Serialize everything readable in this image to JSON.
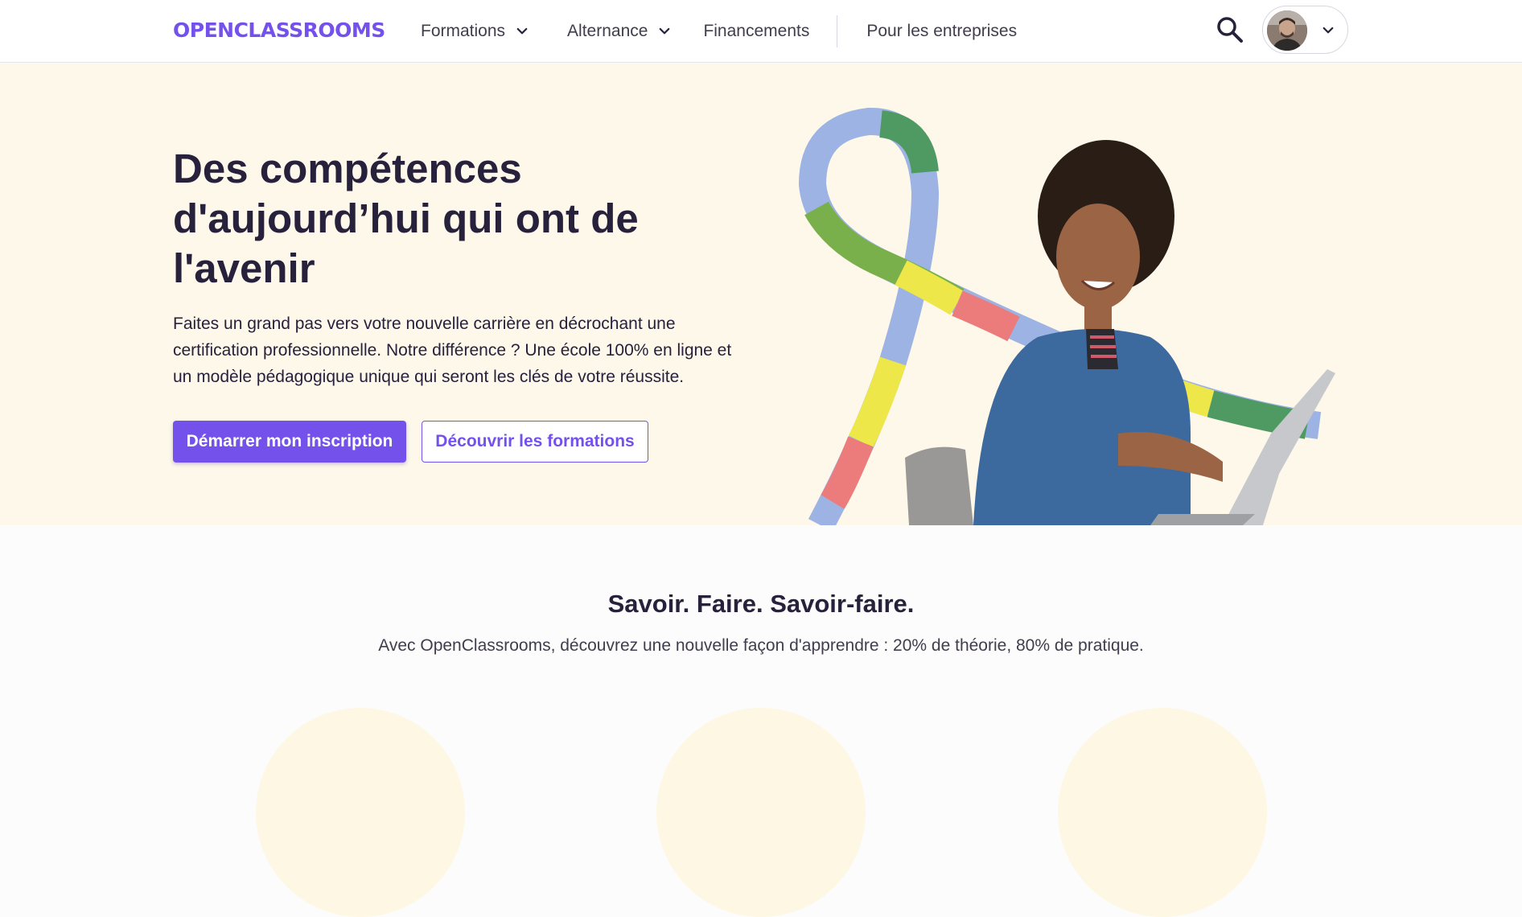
{
  "header": {
    "logo_text": "OPENCLASSROOMS",
    "nav": [
      {
        "label": "Formations",
        "has_dropdown": true
      },
      {
        "label": "Alternance",
        "has_dropdown": true
      },
      {
        "label": "Financements",
        "has_dropdown": false
      },
      {
        "label": "Pour les entreprises",
        "has_dropdown": false
      }
    ],
    "search_icon": "search-icon",
    "user_menu_icon": "chevron-down-icon"
  },
  "hero": {
    "title": "Des compétences d'aujourd’hui qui ont de l'avenir",
    "description": "Faites un grand pas vers votre nouvelle carrière en décrochant une certification professionnelle. Notre différence ? Une école 100% en ligne et un modèle pédagogique unique qui seront les clés de votre réussite.",
    "primary_button": "Démarrer mon inscription",
    "secondary_button": "Découvrir les formations"
  },
  "section": {
    "title": "Savoir. Faire. Savoir-faire.",
    "subtitle": "Avec OpenClassrooms, découvrez une nouvelle façon d'apprendre : 20% de théorie, 80% de pratique."
  },
  "colors": {
    "brand": "#7451eb",
    "text_dark": "#27213c",
    "hero_bg": "#fdf8ea",
    "ribbon_blue": "#9cb3e3",
    "ribbon_green": "#4f9a62",
    "ribbon_yellow": "#eee74a",
    "ribbon_red": "#ec7b7b"
  }
}
